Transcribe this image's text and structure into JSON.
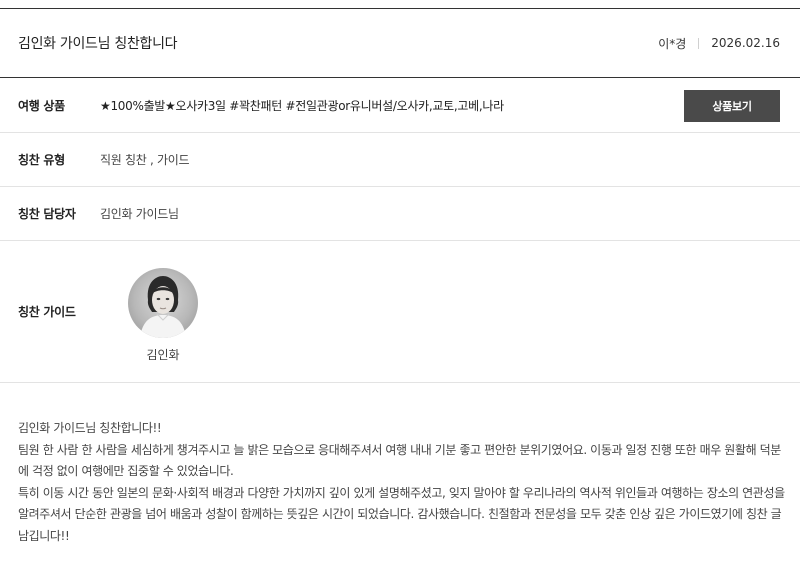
{
  "header": {
    "title": "김인화 가이드님 칭찬합니다",
    "author": "이*경",
    "date": "2026.02.16"
  },
  "rows": {
    "product": {
      "label": "여행 상품",
      "value": "★100%출발★오사카3일 #꽉찬패턴 #전일관광or유니버설/오사카,교토,고베,나라",
      "button_label": "상품보기"
    },
    "type": {
      "label": "칭찬 유형",
      "value": "직원 칭찬 , 가이드"
    },
    "manager": {
      "label": "칭찬 담당자",
      "value": "김인화 가이드님"
    },
    "guide": {
      "label": "칭찬 가이드",
      "name": "김인화"
    }
  },
  "content": {
    "lines": [
      "김인화 가이드님 칭찬합니다!!",
      "팀원 한 사람 한 사람을 세심하게 챙겨주시고 늘 밝은 모습으로 응대해주셔서 여행 내내 기분 좋고 편안한 분위기였어요. 이동과 일정 진행 또한 매우 원활해 덕분에 걱정 없이 여행에만 집중할 수 있었습니다.",
      "특히 이동 시간 동안 일본의 문화·사회적 배경과 다양한 가치까지 깊이 있게 설명해주셨고, 잊지 말아야 할 우리나라의 역사적 위인들과 여행하는 장소의 연관성을 알려주셔서 단순한 관광을 넘어 배움과 성찰이 함께하는 뜻깊은 시간이 되었습니다. 감사했습니다. 친절함과 전문성을 모두 갖춘 인상 깊은 가이드였기에 칭찬 글 남깁니다!!"
    ]
  }
}
